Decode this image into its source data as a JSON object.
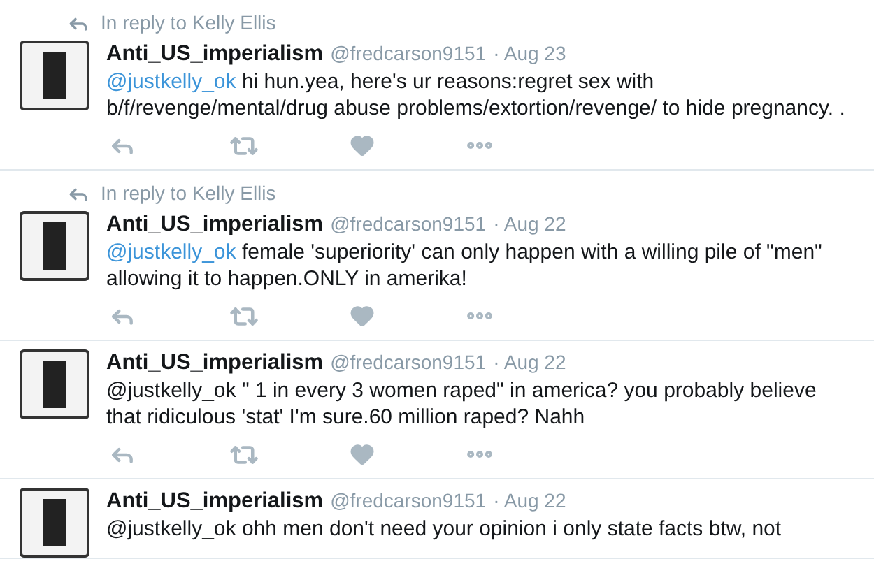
{
  "tweets": [
    {
      "in_reply_to": "In reply to Kelly Ellis",
      "name": "Anti_US_imperialism",
      "handle": "@fredcarson9151",
      "date": "· Aug 23",
      "mention": "@justkelly_ok",
      "mention_linked": true,
      "text": "hi hun.yea, here's ur reasons:regret sex with b/f/revenge/mental/drug abuse problems/extortion/revenge/ to hide pregnancy. ."
    },
    {
      "in_reply_to": "In reply to Kelly Ellis",
      "name": "Anti_US_imperialism",
      "handle": "@fredcarson9151",
      "date": "· Aug 22",
      "mention": "@justkelly_ok",
      "mention_linked": true,
      "text": "female 'superiority' can only happen with a willing pile of \"men\" allowing it to happen.ONLY in amerika!"
    },
    {
      "name": "Anti_US_imperialism",
      "handle": "@fredcarson9151",
      "date": "· Aug 22",
      "mention": "@justkelly_ok",
      "mention_linked": false,
      "text": "\" 1 in every 3 women raped\" in america? you probably believe that ridiculous 'stat' I'm sure.60 million raped? Nahh"
    },
    {
      "name": "Anti_US_imperialism",
      "handle": "@fredcarson9151",
      "date": "· Aug 22",
      "mention": "@justkelly_ok",
      "mention_linked": false,
      "text": "ohh men don't need your opinion i only state facts btw, not"
    }
  ]
}
